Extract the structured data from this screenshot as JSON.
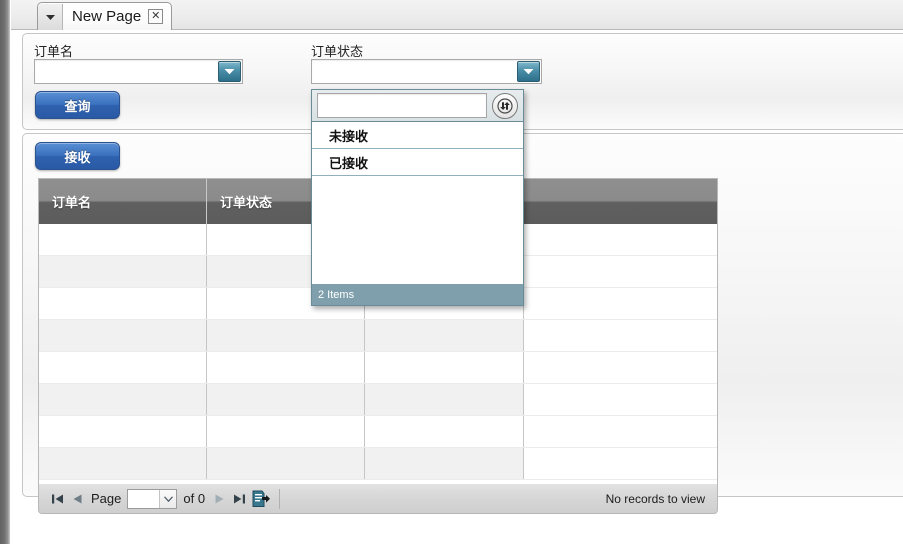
{
  "window": {
    "tab": {
      "title": "New Page",
      "dropdown_icon": "chevron-down-icon",
      "close_icon": "close-box-icon"
    }
  },
  "search_panel": {
    "fields": [
      {
        "label": "订单名",
        "value": "",
        "placeholder": "",
        "icon": "chevron-down-icon"
      },
      {
        "label": "订单状态",
        "value": "",
        "placeholder": "",
        "icon": "chevron-down-icon"
      }
    ],
    "query_button": "查询"
  },
  "grid_panel": {
    "receive_button": "接收",
    "columns": [
      "订单名",
      "订单状态",
      "",
      ""
    ],
    "rows": [],
    "empty_row_count": 8,
    "pager": {
      "first_icon": "first-page-icon",
      "prev_icon": "prev-page-icon",
      "page_label": "Page",
      "page_value": "",
      "of_label": "of 0",
      "next_icon": "next-page-icon",
      "last_icon": "last-page-icon",
      "export_icon": "export-document-icon",
      "status": "No records to view"
    }
  },
  "status_dropdown": {
    "open": true,
    "filter_value": "",
    "filter_placeholder": "",
    "refresh_icon": "refresh-swap-icon",
    "items": [
      {
        "label": "未接收"
      },
      {
        "label": "已接收"
      }
    ],
    "footer": "2 Items"
  },
  "colors": {
    "accent_blue": "#3a71be",
    "combo_button": "#2d6f8a",
    "header_gray": "#5c5c5c",
    "footer_steel": "#7f9fad",
    "popup_border": "#6a8c99"
  }
}
